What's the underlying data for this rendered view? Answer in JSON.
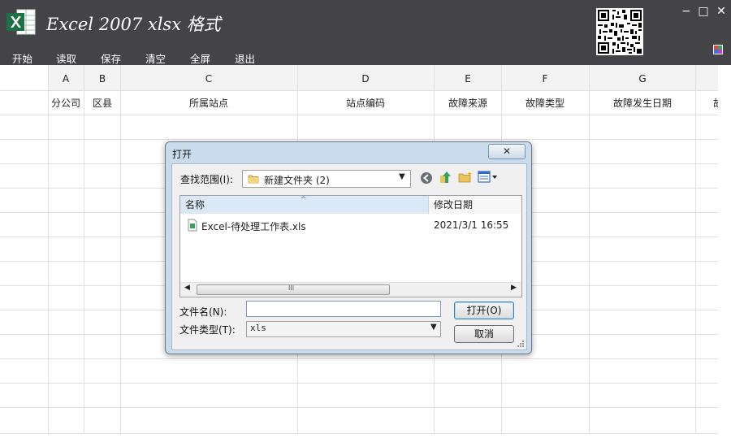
{
  "window": {
    "title": "Excel 2007 xlsx 格式",
    "minimize": "−",
    "maximize": "□",
    "close": "✕"
  },
  "menu": [
    "开始",
    "读取",
    "保存",
    "清空",
    "全屏",
    "退出"
  ],
  "sheet": {
    "columns": [
      "A",
      "B",
      "C",
      "D",
      "E",
      "F",
      "G"
    ],
    "headers": [
      "分公司",
      "区县",
      "所属站点",
      "站点编码",
      "故障来源",
      "故障类型",
      "故障发生日期"
    ],
    "partial_header": "故"
  },
  "dialog": {
    "title": "打开",
    "close": "✕",
    "look_in_label": "查找范围(I):",
    "look_in_value": "新建文件夹 (2)",
    "list_headers": {
      "name": "名称",
      "modified": "修改日期"
    },
    "files": [
      {
        "name": "Excel-待处理工作表.xls",
        "modified": "2021/3/1 16:55"
      }
    ],
    "scroll_grip": "III",
    "filename_label": "文件名(N):",
    "filename_value": "",
    "filetype_label": "文件类型(T):",
    "filetype_value": "xls",
    "open_button": "打开(O)",
    "cancel_button": "取消"
  },
  "colors": {
    "titlebar": "#444448",
    "excel_green": "#1e7145",
    "dialog_frame": "#c9dcee",
    "selection": "#dceaf7"
  }
}
